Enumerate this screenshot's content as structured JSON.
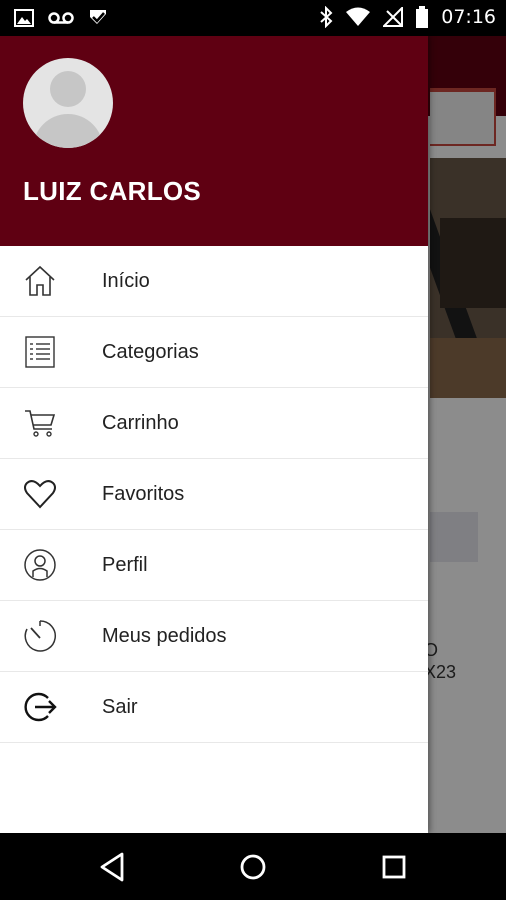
{
  "status_bar": {
    "time": "07:16",
    "left_icons": [
      "image-icon",
      "voicemail-icon",
      "check-icon"
    ],
    "right_icons": [
      "bluetooth-icon",
      "wifi-icon",
      "no-signal-icon",
      "battery-icon"
    ]
  },
  "background": {
    "visible_text_1": "O",
    "visible_text_2": "X23"
  },
  "drawer": {
    "user_name": "LUIZ CARLOS",
    "menu": [
      {
        "label": "Início",
        "icon": "home-icon"
      },
      {
        "label": "Categorias",
        "icon": "list-icon"
      },
      {
        "label": "Carrinho",
        "icon": "cart-icon"
      },
      {
        "label": "Favoritos",
        "icon": "heart-icon"
      },
      {
        "label": "Perfil",
        "icon": "profile-icon"
      },
      {
        "label": "Meus pedidos",
        "icon": "timer-icon"
      },
      {
        "label": "Sair",
        "icon": "logout-icon"
      }
    ]
  },
  "nav_bar": {
    "buttons": [
      "back-icon",
      "home-circle-icon",
      "recents-icon"
    ]
  },
  "colors": {
    "brand": "#5f0012",
    "drawer_bg": "#ffffff",
    "text": "#222222"
  }
}
